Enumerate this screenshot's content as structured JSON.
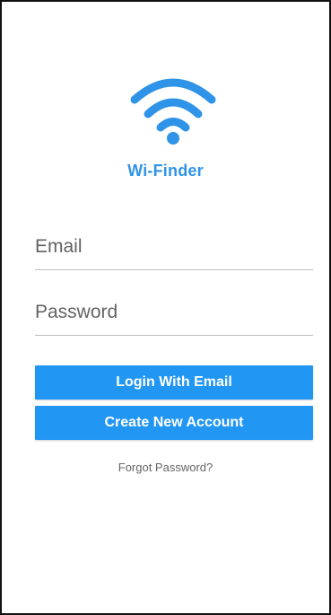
{
  "app": {
    "name": "Wi-Finder",
    "logo_icon": "wifi-icon",
    "accent_color": "#2196f3"
  },
  "form": {
    "email_placeholder": "Email",
    "password_placeholder": "Password"
  },
  "buttons": {
    "login_label": "Login With Email",
    "create_account_label": "Create New Account"
  },
  "links": {
    "forgot_password": "Forgot Password?"
  }
}
